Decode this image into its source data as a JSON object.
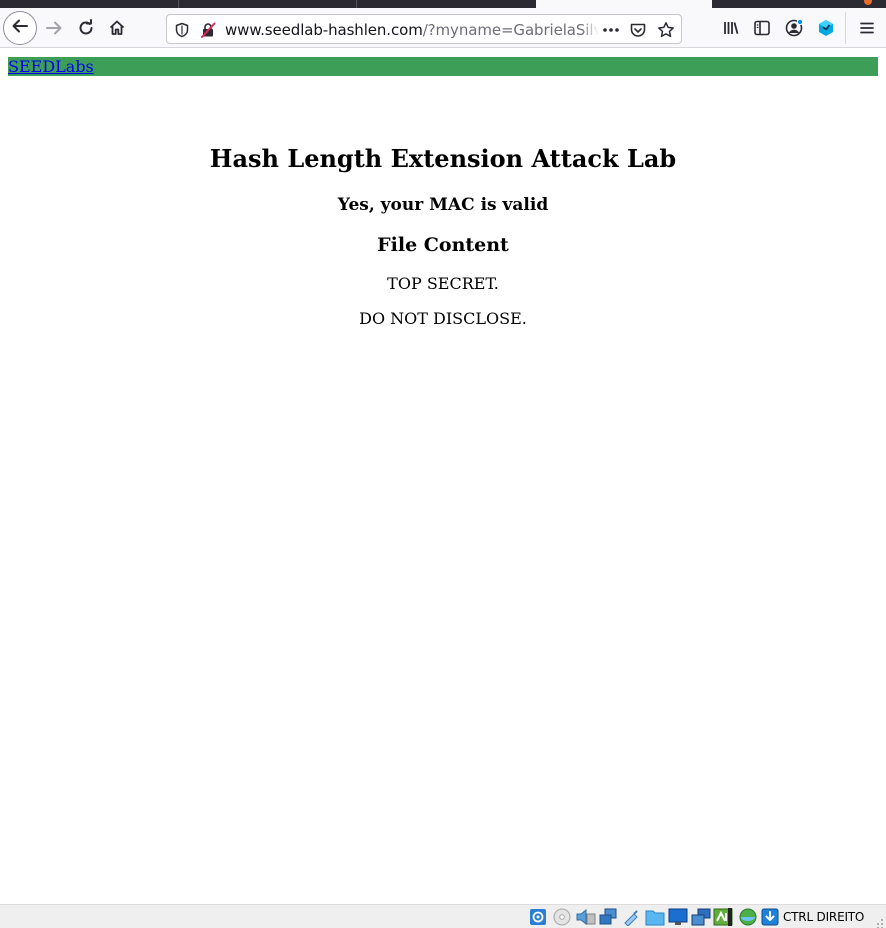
{
  "browser": {
    "url_domain": "www.seedlab-hashlen.com",
    "url_path": "/?myname=GabrielaSilva&",
    "icons": {
      "back": "back-arrow-icon",
      "forward": "forward-arrow-icon",
      "reload": "reload-icon",
      "home": "home-icon",
      "tracking_shield": "shield-icon",
      "insecure": "insecure-lock-icon",
      "page_actions": "more-horizontal-icon",
      "pocket": "pocket-icon",
      "bookmark": "star-icon",
      "library": "library-icon",
      "sidebar": "sidebar-icon",
      "account": "account-icon",
      "extension": "extension-icon",
      "menu": "hamburger-menu-icon"
    }
  },
  "page": {
    "nav_link": "SEEDLabs",
    "nav_bg": "#3d9e57",
    "title": "Hash Length Extension Attack Lab",
    "status": "Yes, your MAC is valid",
    "section_heading": "File Content",
    "lines": [
      "TOP SECRET.",
      "DO NOT DISCLOSE."
    ]
  },
  "statusbar": {
    "host_key": "CTRL DIREITO",
    "icons": [
      "hard-disk-icon",
      "optical-drive-icon",
      "audio-icon",
      "network-icon",
      "usb-icon",
      "shared-folders-icon",
      "display-icon",
      "video-capture-icon",
      "cpu-icon",
      "mouse-integration-icon",
      "download-icon"
    ]
  }
}
